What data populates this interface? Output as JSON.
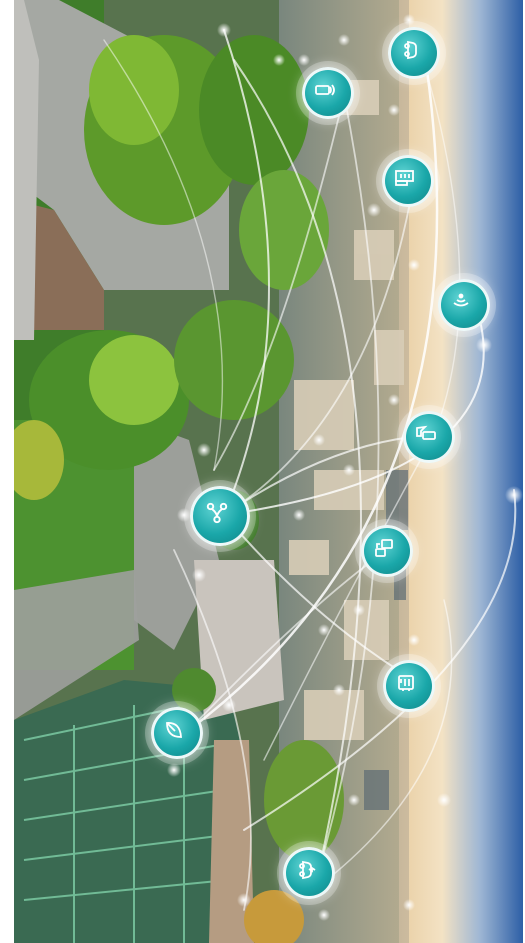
{
  "image": {
    "description_icons": [
      "car-icon",
      "smartphone-wifi-icon",
      "building-icon",
      "wifi-signal-icon",
      "phone-hand-icon",
      "network-hub-icon",
      "device-connect-icon",
      "energy-meter-icon",
      "leaf-icon",
      "electric-car-icon"
    ],
    "colors": {
      "node_teal": "#1aa7a9",
      "sky_blue": "#3f6fb3",
      "sunset_cream": "#f3dfbf",
      "grass_green": "#3e8a2a",
      "line_glow": "#ffffff"
    }
  }
}
